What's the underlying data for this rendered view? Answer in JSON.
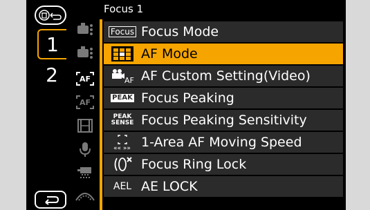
{
  "menu": {
    "title": "Focus 1",
    "items": [
      {
        "icon": "focus-mode-icon",
        "badge": "Focus",
        "label": "Focus Mode",
        "selected": false
      },
      {
        "icon": "af-mode-icon",
        "label": "AF Mode",
        "selected": true
      },
      {
        "icon": "movie-af-icon",
        "label": "AF Custom Setting(Video)",
        "selected": false
      },
      {
        "icon": "peak-icon",
        "badge": "PEAK",
        "label": "Focus Peaking",
        "selected": false
      },
      {
        "icon": "peak-sense-icon",
        "badge_top": "PEAK",
        "badge_bottom": "SENSE",
        "label": "Focus Peaking Sensitivity",
        "selected": false
      },
      {
        "icon": "af-area-move-icon",
        "label": "1-Area AF Moving Speed",
        "selected": false
      },
      {
        "icon": "focus-ring-lock-icon",
        "label": "Focus Ring Lock",
        "selected": false
      },
      {
        "icon": "ael-icon",
        "badge": "AEL",
        "label": "AE LOCK",
        "selected": false
      }
    ]
  },
  "tabs": {
    "page1": "1",
    "page2": "2"
  },
  "categories": [
    "camera-icon",
    "camera-icon",
    "af-icon",
    "af-icon",
    "film-icon",
    "mic-icon",
    "tripod-icon",
    "lens-icon"
  ],
  "colors": {
    "accent": "#f5a400",
    "row_bg": "#2b2b2b",
    "screen_bg": "#000000"
  }
}
